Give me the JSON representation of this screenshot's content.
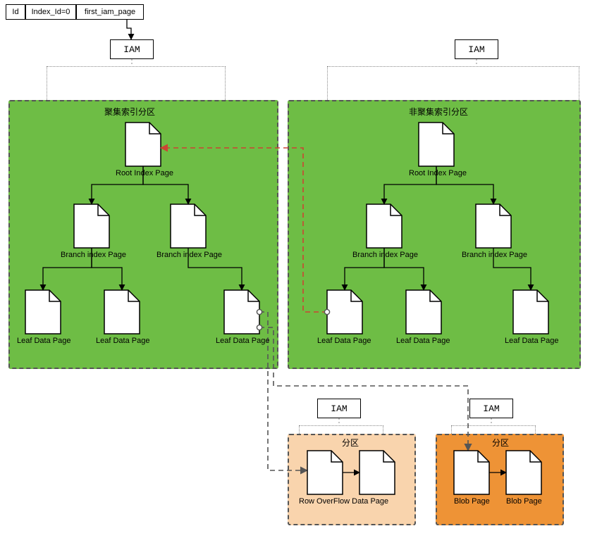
{
  "table_row": {
    "id": "Id",
    "index": "Index_Id=0",
    "first_iam": "first_iam_page"
  },
  "iam_label": "IAM",
  "partition_left_title": "聚集索引分区",
  "partition_right_title": "非聚集索引分区",
  "partition_overflow_title": "分区",
  "partition_blob_title": "分区",
  "labels": {
    "root": "Root Index Page",
    "branch": "Branch index Page",
    "leaf": "Leaf Data Page",
    "overflow": "Row OverFlow Data Page",
    "blob": "Blob Page"
  },
  "chart_data": {
    "type": "diagram",
    "description": "Database index storage structure with clustered and nonclustered index partitions, IAM chains, row-overflow and blob pages.",
    "nodes": [
      {
        "id": "id",
        "label": "Id"
      },
      {
        "id": "index_id",
        "label": "Index_Id=0"
      },
      {
        "id": "first_iam_page",
        "label": "first_iam_page"
      },
      {
        "id": "iam1",
        "label": "IAM"
      },
      {
        "id": "iam2",
        "label": "IAM"
      },
      {
        "id": "iam3",
        "label": "IAM"
      },
      {
        "id": "iam4",
        "label": "IAM"
      },
      {
        "id": "cluster_partition",
        "label": "聚集索引分区"
      },
      {
        "id": "cluster_root",
        "label": "Root Index Page"
      },
      {
        "id": "cluster_branch1",
        "label": "Branch index Page"
      },
      {
        "id": "cluster_branch2",
        "label": "Branch index Page"
      },
      {
        "id": "cluster_leaf1",
        "label": "Leaf Data Page"
      },
      {
        "id": "cluster_leaf2",
        "label": "Leaf Data Page"
      },
      {
        "id": "cluster_leaf3",
        "label": "Leaf Data Page"
      },
      {
        "id": "noncluster_partition",
        "label": "非聚集索引分区"
      },
      {
        "id": "noncluster_root",
        "label": "Root Index Page"
      },
      {
        "id": "noncluster_branch1",
        "label": "Branch index Page"
      },
      {
        "id": "noncluster_branch2",
        "label": "Branch index Page"
      },
      {
        "id": "noncluster_leaf1",
        "label": "Leaf Data Page"
      },
      {
        "id": "noncluster_leaf2",
        "label": "Leaf Data Page"
      },
      {
        "id": "noncluster_leaf3",
        "label": "Leaf Data Page"
      },
      {
        "id": "overflow_partition",
        "label": "分区"
      },
      {
        "id": "overflow_page1",
        "label": "Row OverFlow Data Page"
      },
      {
        "id": "overflow_page2",
        "label": ""
      },
      {
        "id": "blob_partition",
        "label": "分区"
      },
      {
        "id": "blob_page1",
        "label": "Blob Page"
      },
      {
        "id": "blob_page2",
        "label": "Blob Page"
      }
    ],
    "edges": [
      {
        "from": "first_iam_page",
        "to": "iam1",
        "style": "solid"
      },
      {
        "from": "iam1",
        "to": "cluster_partition",
        "style": "dotted"
      },
      {
        "from": "cluster_root",
        "to": "cluster_branch1",
        "style": "solid"
      },
      {
        "from": "cluster_root",
        "to": "cluster_branch2",
        "style": "solid"
      },
      {
        "from": "cluster_branch1",
        "to": "cluster_leaf1",
        "style": "solid"
      },
      {
        "from": "cluster_branch1",
        "to": "cluster_leaf2",
        "style": "solid"
      },
      {
        "from": "cluster_branch2",
        "to": "cluster_leaf3",
        "style": "solid"
      },
      {
        "from": "iam2",
        "to": "noncluster_partition",
        "style": "dotted"
      },
      {
        "from": "noncluster_root",
        "to": "noncluster_branch1",
        "style": "solid"
      },
      {
        "from": "noncluster_root",
        "to": "noncluster_branch2",
        "style": "solid"
      },
      {
        "from": "noncluster_branch1",
        "to": "noncluster_leaf1",
        "style": "solid"
      },
      {
        "from": "noncluster_branch1",
        "to": "noncluster_leaf2",
        "style": "solid"
      },
      {
        "from": "noncluster_branch2",
        "to": "noncluster_leaf3",
        "style": "solid"
      },
      {
        "from": "noncluster_leaf1",
        "to": "cluster_root",
        "style": "red-dashed",
        "note": "points back to clustered index"
      },
      {
        "from": "cluster_leaf3",
        "to": "overflow_page1",
        "style": "dashed"
      },
      {
        "from": "cluster_leaf3",
        "to": "blob_page1",
        "style": "dashed"
      },
      {
        "from": "overflow_page1",
        "to": "overflow_page2",
        "style": "solid"
      },
      {
        "from": "blob_page1",
        "to": "blob_page2",
        "style": "solid"
      },
      {
        "from": "iam3",
        "to": "overflow_partition",
        "style": "dotted"
      },
      {
        "from": "iam4",
        "to": "blob_partition",
        "style": "dotted"
      }
    ]
  }
}
